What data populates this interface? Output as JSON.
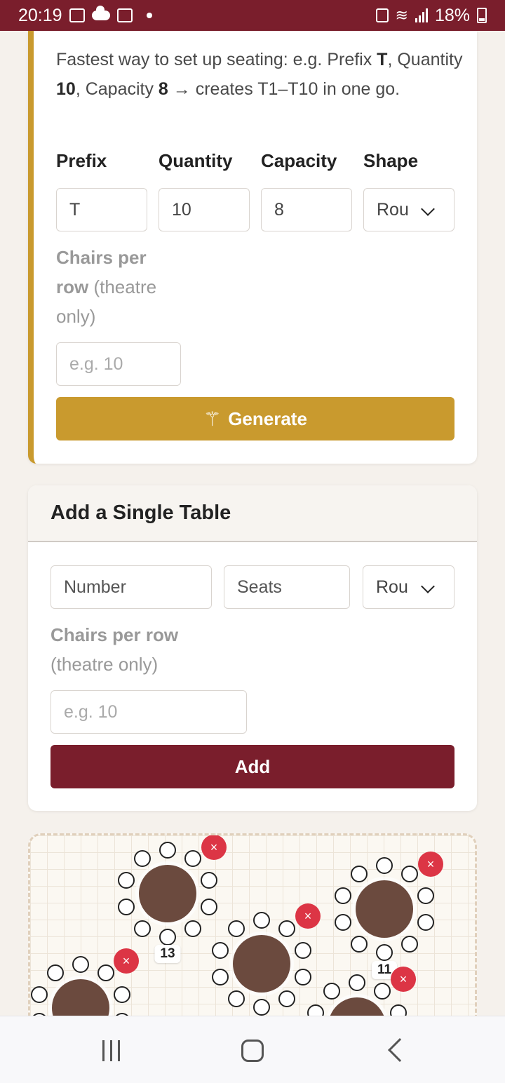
{
  "status_bar": {
    "time": "20:19",
    "battery": "18%",
    "icons": [
      "gallery-icon",
      "cloud-icon",
      "calendar-icon",
      "notification-dot-icon",
      "lock-icon",
      "wifi-icon",
      "signal-icon",
      "battery-icon"
    ]
  },
  "bulk": {
    "help_pre": "Fastest way to set up seating: e.g. Prefix ",
    "help_prefix": "T",
    "help_mid1": ", Quantity ",
    "help_quantity": "10",
    "help_mid2": ", Capacity ",
    "help_capacity": "8",
    "help_post": " → creates T1–T10 in one go.",
    "labels": {
      "prefix": "Prefix",
      "quantity": "Quantity",
      "capacity": "Capacity",
      "shape": "Shape"
    },
    "values": {
      "prefix": "T",
      "quantity": "10",
      "capacity": "8",
      "shape": "Rou"
    },
    "chairs_label_bold1": "Chairs per",
    "chairs_label_bold2": "row",
    "chairs_label_rest1": " (theatre",
    "chairs_label_rest2": "only)",
    "chairs_placeholder": "e.g. 10",
    "generate_label": "Generate"
  },
  "single": {
    "title": "Add a Single Table",
    "number_placeholder": "Number",
    "seats_placeholder": "Seats",
    "shape_value": "Rou",
    "chairs_label_bold": "Chairs per row",
    "chairs_label_rest": "(theatre only)",
    "chairs_placeholder": "e.g. 10",
    "add_label": "Add"
  },
  "floor_plan": {
    "tables": [
      {
        "label": "13",
        "seats": 10,
        "delete": "×"
      },
      {
        "label": "",
        "seats": 10,
        "delete": "×"
      },
      {
        "label": "11",
        "seats": 10,
        "delete": "×"
      },
      {
        "label": "",
        "seats": 10,
        "delete": "×"
      },
      {
        "label": "",
        "seats": 10,
        "delete": "×"
      }
    ]
  },
  "nav": {
    "icons": [
      "recent-apps-icon",
      "home-icon",
      "back-icon"
    ]
  },
  "colors": {
    "brand": "#7a1e2c",
    "accent": "#c99a2e",
    "delete": "#dc3545",
    "table": "#6b4a3e"
  }
}
